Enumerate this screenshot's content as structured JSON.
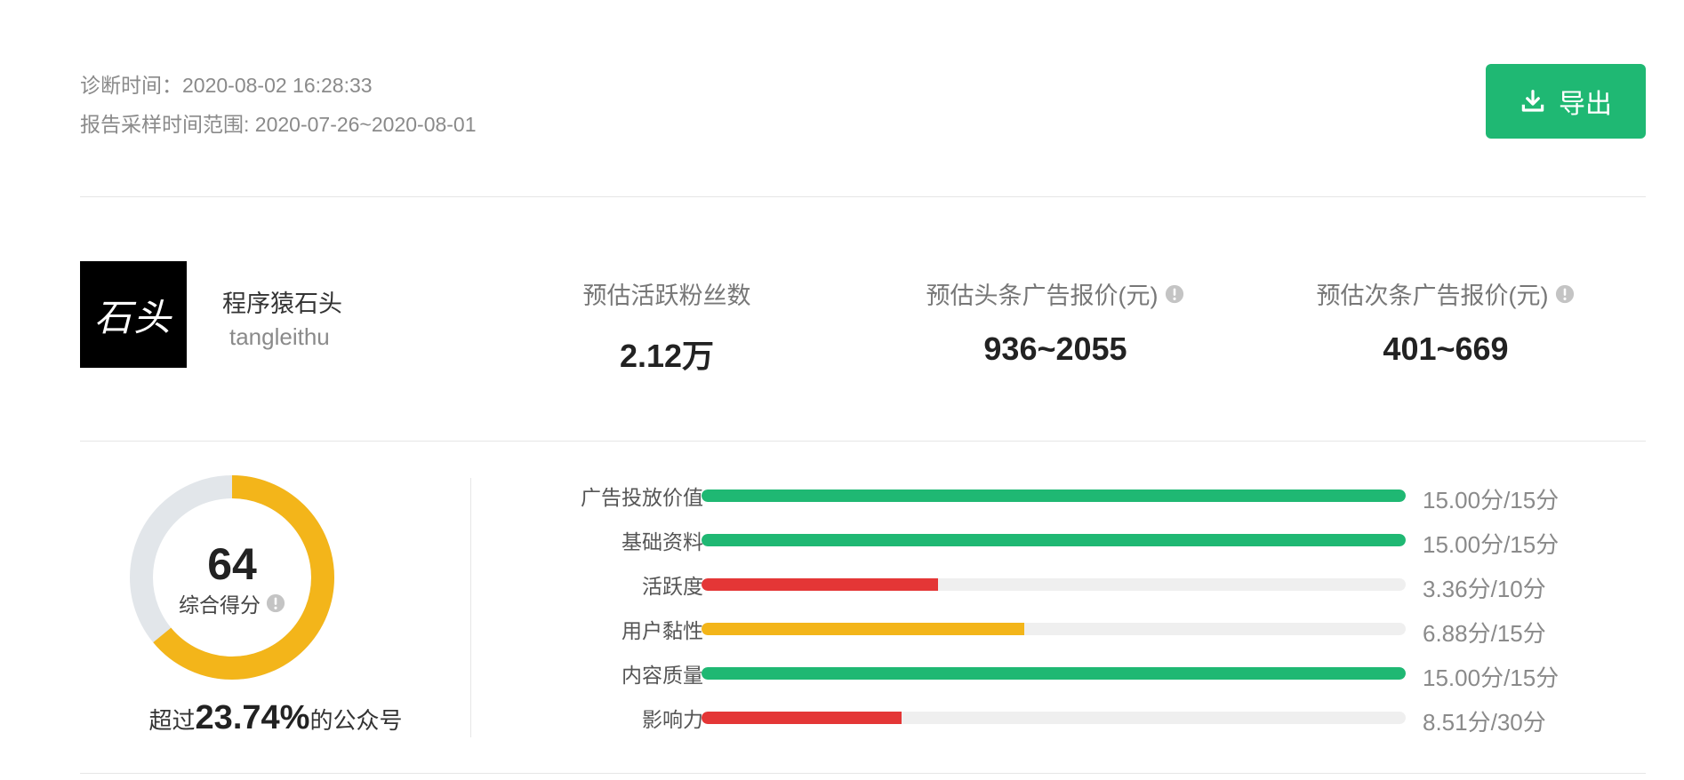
{
  "header": {
    "diagnose_time": "诊断时间：2020-08-02 16:28:33",
    "sample_range": "报告采样时间范围: 2020-07-26~2020-08-01",
    "export_label": "导出"
  },
  "account": {
    "avatar_text": "石头",
    "name": "程序猿石头",
    "id": "tangleithu"
  },
  "stats": [
    {
      "label": "预估活跃粉丝数",
      "value": "2.12万",
      "info": false
    },
    {
      "label": "预估头条广告报价(元)",
      "value": "936~2055",
      "info": true
    },
    {
      "label": "预估次条广告报价(元)",
      "value": "401~669",
      "info": true
    }
  ],
  "score": {
    "value": "64",
    "label": "综合得分",
    "exceed_prefix": "超过",
    "exceed_pct": "23.74%",
    "exceed_suffix": "的公众号",
    "ring_fraction": 0.64
  },
  "metrics": [
    {
      "label": "广告投放价值",
      "value_text": "15.00分/15分",
      "fraction": 1.0,
      "color": "#1fb873"
    },
    {
      "label": "基础资料",
      "value_text": "15.00分/15分",
      "fraction": 1.0,
      "color": "#1fb873"
    },
    {
      "label": "活跃度",
      "value_text": "3.36分/10分",
      "fraction": 0.336,
      "color": "#e43636"
    },
    {
      "label": "用户黏性",
      "value_text": "6.88分/15分",
      "fraction": 0.4587,
      "color": "#f3b51a"
    },
    {
      "label": "内容质量",
      "value_text": "15.00分/15分",
      "fraction": 1.0,
      "color": "#1fb873"
    },
    {
      "label": "影响力",
      "value_text": "8.51分/30分",
      "fraction": 0.2837,
      "color": "#e43636"
    }
  ],
  "colors": {
    "accent": "#1fb873",
    "ring_track": "#e2e6ea",
    "ring_fill": "#f3b51a"
  }
}
